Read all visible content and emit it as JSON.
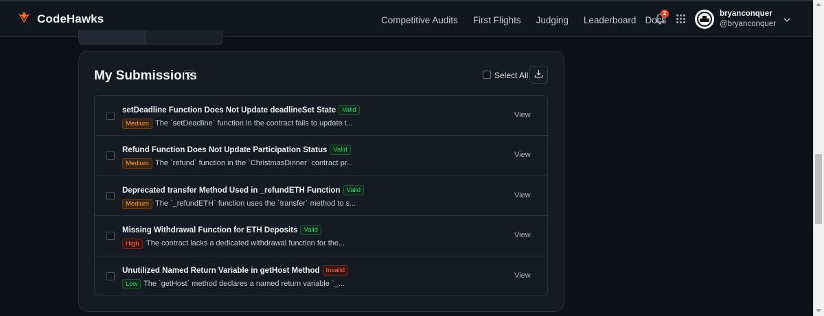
{
  "app": {
    "name": "CodeHawks"
  },
  "nav": {
    "items": [
      "Competitive Audits",
      "First Flights",
      "Judging",
      "Leaderboard",
      "Docs"
    ],
    "notification_count": "2"
  },
  "user": {
    "name": "bryanconquer",
    "handle": "@bryanconquer"
  },
  "submissions": {
    "title": "My Submissions",
    "count": "5",
    "select_all_label": "Select All",
    "view_label": "View",
    "items": [
      {
        "title": "setDeadline Function Does Not Update deadlineSet State",
        "status": "Valid",
        "severity": "Medium",
        "description": "The `setDeadline` function in the contract fails to update t..."
      },
      {
        "title": "Refund Function Does Not Update Participation Status",
        "status": "Valid",
        "severity": "Medium",
        "description": "The `refund` function in the `ChristmasDinner` contract pr..."
      },
      {
        "title": "Deprecated transfer Method Used in _refundETH Function",
        "status": "Valid",
        "severity": "Medium",
        "description": "The `_refundETH` function uses the `transfer` method to s..."
      },
      {
        "title": "Missing Withdrawal Function for ETH Deposits",
        "status": "Valid",
        "severity": "High",
        "description": "The contract lacks a dedicated withdrawal function for the..."
      },
      {
        "title": "Unutilized Named Return Variable in getHost Method",
        "status": "Invalid",
        "severity": "Low",
        "description": "The `getHost` method declares a named return variable `_..."
      }
    ]
  },
  "colors": {
    "background": "#0d1018",
    "card": "#161a23",
    "brand": "#f36b2b",
    "valid": "#3fd07a",
    "invalid": "#ff6b5c",
    "medium": "#f5a445"
  }
}
